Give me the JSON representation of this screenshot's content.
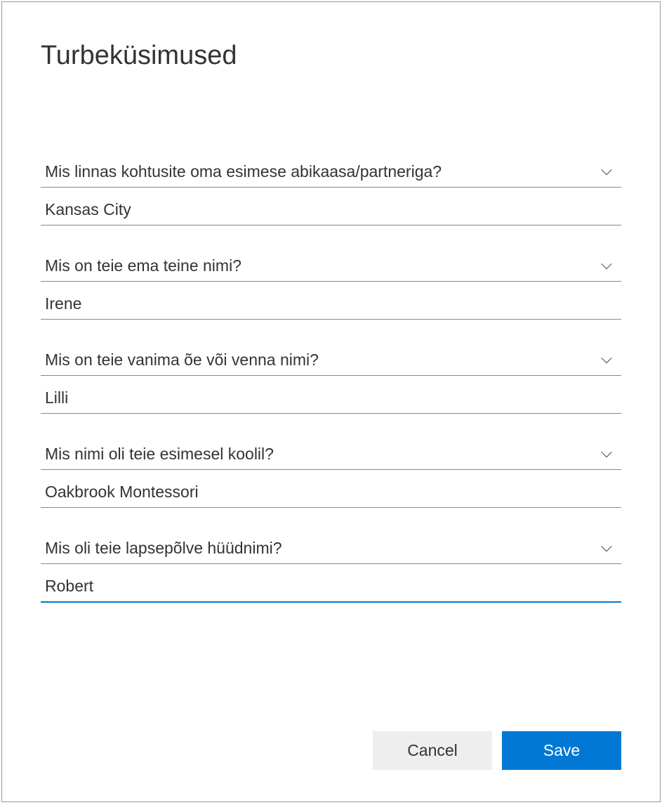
{
  "title": "Turbeküsimused",
  "questions": [
    {
      "question": "Mis linnas kohtusite oma esimese abikaasa/partneriga?",
      "answer": "Kansas City",
      "active": false
    },
    {
      "question": "Mis on teie ema teine nimi?",
      "answer": "Irene",
      "active": false
    },
    {
      "question": "Mis on teie vanima õe või venna nimi?",
      "answer": "Lilli",
      "active": false
    },
    {
      "question": "Mis nimi oli teie esimesel koolil?",
      "answer": "Oakbrook Montessori",
      "active": false
    },
    {
      "question": "Mis oli teie lapsepõlve hüüdnimi?",
      "answer": "Robert",
      "active": true
    }
  ],
  "buttons": {
    "cancel": "Cancel",
    "save": "Save"
  }
}
